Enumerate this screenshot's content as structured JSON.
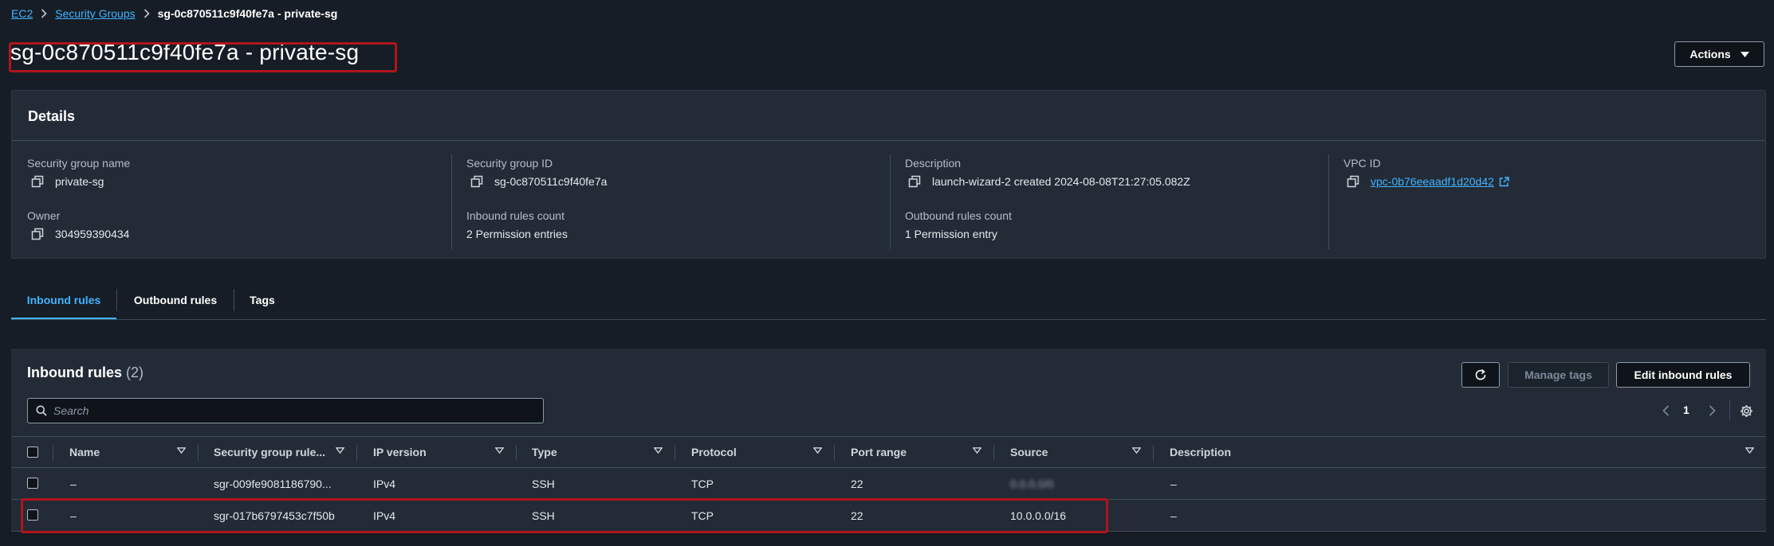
{
  "breadcrumb": {
    "items": [
      "EC2",
      "Security Groups"
    ],
    "current": "sg-0c870511c9f40fe7a - private-sg"
  },
  "page": {
    "title": "sg-0c870511c9f40fe7a - private-sg",
    "actions_label": "Actions"
  },
  "details": {
    "heading": "Details",
    "fields": {
      "sg_name_label": "Security group name",
      "sg_name": "private-sg",
      "sg_id_label": "Security group ID",
      "sg_id": "sg-0c870511c9f40fe7a",
      "description_label": "Description",
      "description": "launch-wizard-2 created 2024-08-08T21:27:05.082Z",
      "vpc_label": "VPC ID",
      "vpc_id": "vpc-0b76eeaadf1d20d42",
      "owner_label": "Owner",
      "owner": "304959390434",
      "inbound_count_label": "Inbound rules count",
      "inbound_count": "2 Permission entries",
      "outbound_count_label": "Outbound rules count",
      "outbound_count": "1 Permission entry"
    }
  },
  "tabs": [
    {
      "label": "Inbound rules",
      "active": true
    },
    {
      "label": "Outbound rules",
      "active": false
    },
    {
      "label": "Tags",
      "active": false
    }
  ],
  "inbound": {
    "title": "Inbound rules",
    "count": "(2)",
    "manage_tags_label": "Manage tags",
    "edit_label": "Edit inbound rules",
    "search_placeholder": "Search",
    "page_number": "1",
    "columns": [
      "Name",
      "Security group rule...",
      "IP version",
      "Type",
      "Protocol",
      "Port range",
      "Source",
      "Description"
    ],
    "rows": [
      {
        "name": "–",
        "rule_id": "sgr-009fe9081186790...",
        "ip_version": "IPv4",
        "type": "SSH",
        "protocol": "TCP",
        "port_range": "22",
        "source": "0.0.0.0/0",
        "source_blurred": true,
        "description": "–"
      },
      {
        "name": "–",
        "rule_id": "sgr-017b6797453c7f50b",
        "ip_version": "IPv4",
        "type": "SSH",
        "protocol": "TCP",
        "port_range": "22",
        "source": "10.0.0.0/16",
        "source_blurred": false,
        "description": "–"
      }
    ]
  },
  "colors": {
    "background": "#161d26",
    "panel": "#232b37",
    "link": "#42b4ff",
    "annotation": "#b0151b"
  }
}
